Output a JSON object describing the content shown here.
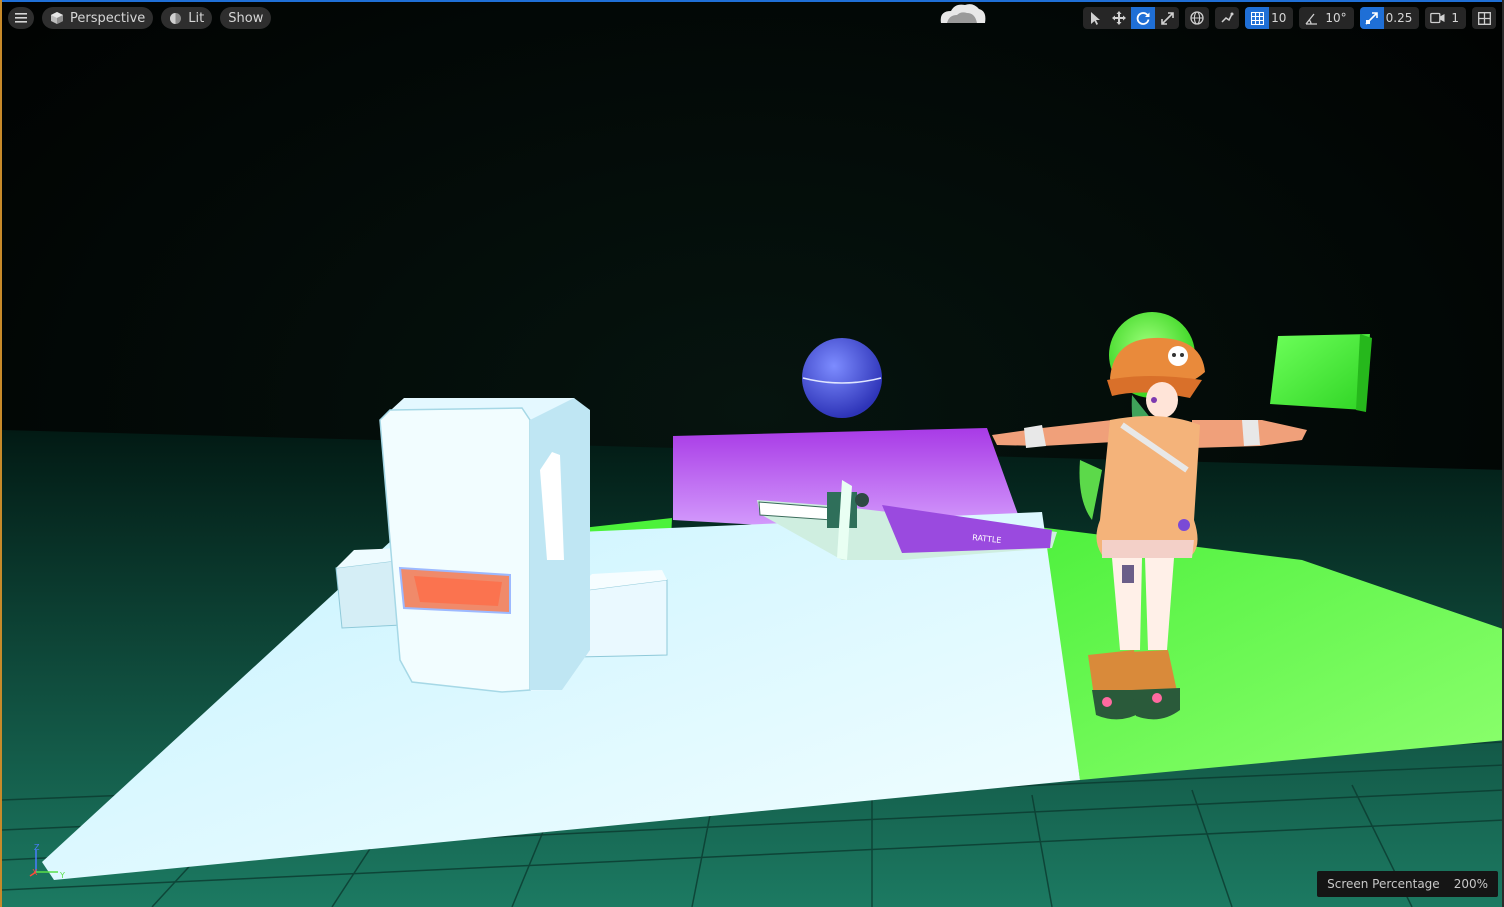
{
  "toolbar": {
    "menu_icon": "hamburger-icon",
    "view_mode": "Perspective",
    "lighting_mode": "Lit",
    "show_label": "Show",
    "grid_snap_value": "10",
    "rotation_snap_value": "10°",
    "scale_snap_value": "0.25",
    "camera_speed_value": "1"
  },
  "status_bar": {
    "label": "Screen Percentage",
    "value": "200%"
  },
  "axis_labels": {
    "x": "X",
    "y": "Y",
    "z": "Z"
  },
  "colors": {
    "accent": "#1f6fd6",
    "viewport_left_border": "#c78a2a",
    "floor_white": "#e8fbff",
    "floor_green": "#5cff46",
    "purple_wall": "#b044ec",
    "sphere_blue": "#4a57e0",
    "grid_teal": "#1c6f5a"
  }
}
